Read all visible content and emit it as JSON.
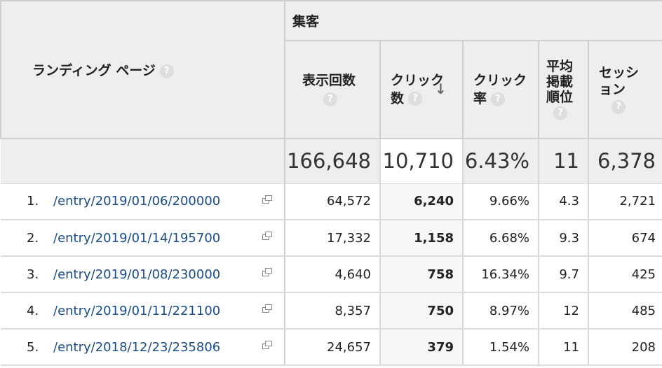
{
  "header": {
    "landing_page_label": "ランディング ページ",
    "group_label": "集客",
    "columns": [
      {
        "line1": "表示回数",
        "line2": "",
        "line3": ""
      },
      {
        "line1": "クリック",
        "line2": "数",
        "line3": ""
      },
      {
        "line1": "クリック",
        "line2": "率",
        "line3": ""
      },
      {
        "line1": "平均",
        "line2": "掲載",
        "line3": "順位"
      },
      {
        "line1": "セッシ",
        "line2": "ョン",
        "line3": ""
      }
    ],
    "help_glyph": "?",
    "sort_arrow": "↓"
  },
  "totals": [
    "166,648",
    "10,710",
    "6.43%",
    "11",
    "6,378"
  ],
  "rows": [
    {
      "index": "1.",
      "page": "/entry/2019/01/06/200000",
      "impressions": "64,572",
      "clicks": "6,240",
      "ctr": "9.66%",
      "position": "4.3",
      "sessions": "2,721"
    },
    {
      "index": "2.",
      "page": "/entry/2019/01/14/195700",
      "impressions": "17,332",
      "clicks": "1,158",
      "ctr": "6.68%",
      "position": "9.3",
      "sessions": "674"
    },
    {
      "index": "3.",
      "page": "/entry/2019/01/08/230000",
      "impressions": "4,640",
      "clicks": "758",
      "ctr": "16.34%",
      "position": "9.7",
      "sessions": "425"
    },
    {
      "index": "4.",
      "page": "/entry/2019/01/11/221100",
      "impressions": "8,357",
      "clicks": "750",
      "ctr": "8.97%",
      "position": "12",
      "sessions": "485"
    },
    {
      "index": "5.",
      "page": "/entry/2018/12/23/235806",
      "impressions": "24,657",
      "clicks": "379",
      "ctr": "1.54%",
      "position": "11",
      "sessions": "208"
    }
  ],
  "colors": {
    "link": "#1a4c8a",
    "header_bg": "#eeeeee",
    "border": "#cfcfcf"
  },
  "icons": {
    "help": "help-icon",
    "external": "open-in-new-icon",
    "sort": "sort-desc-icon"
  }
}
